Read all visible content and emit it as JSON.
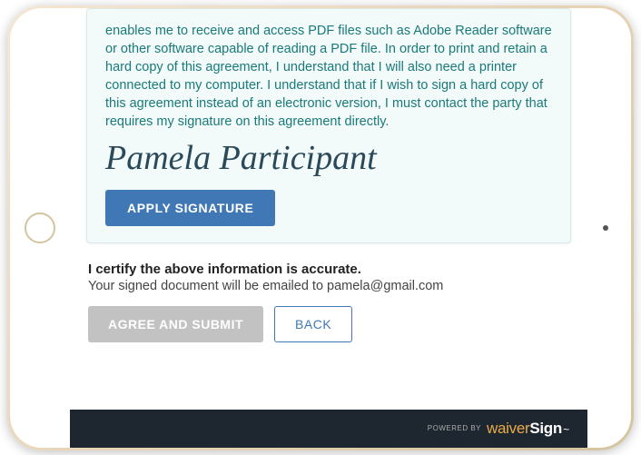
{
  "waiver": {
    "body_text": " enables me to receive and access PDF files such as Adobe Reader software or other software capable of reading a PDF file. In order to print and retain a hard copy of this agreement, I understand that I will also need a printer connected to my computer. I understand that if I wish to sign a hard copy of this agreement instead of an electronic version, I must contact the party that requires my signature on this agreement directly.",
    "signature_name": "Pamela Participant",
    "apply_label": "APPLY SIGNATURE"
  },
  "certify": {
    "heading": "I certify the above information is accurate.",
    "subtext": "Your signed document will be emailed to pamela@gmail.com",
    "agree_label": "AGREE AND SUBMIT",
    "back_label": "BACK"
  },
  "footer": {
    "powered_by": "POWERED BY",
    "brand_a": "waiver",
    "brand_b": "Sign"
  }
}
